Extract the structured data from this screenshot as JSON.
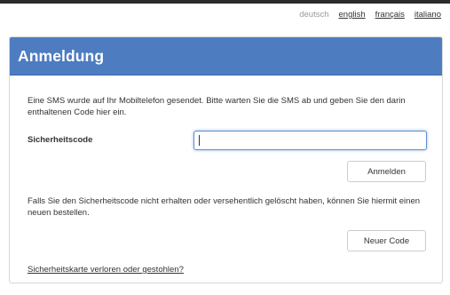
{
  "languages": [
    {
      "label": "deutsch",
      "current": true
    },
    {
      "label": "english",
      "current": false
    },
    {
      "label": "français",
      "current": false
    },
    {
      "label": "italiano",
      "current": false
    }
  ],
  "panel": {
    "title": "Anmeldung",
    "sms_info": "Eine SMS wurde auf Ihr Mobiltelefon gesendet. Bitte warten Sie die SMS ab und geben Sie den darin enthaltenen Code hier ein.",
    "code_label": "Sicherheitscode",
    "code_value": "",
    "login_button": "Anmelden",
    "resend_info": "Falls Sie den Sicherheitscode nicht erhalten oder versehentlich gelöscht haben, können Sie hiermit einen neuen bestellen.",
    "new_code_button": "Neuer Code",
    "lost_card_link": "Sicherheitskarte verloren oder gestohlen?"
  },
  "colors": {
    "header_blue": "#4d7cc0",
    "input_focus": "#5b8fd6"
  }
}
